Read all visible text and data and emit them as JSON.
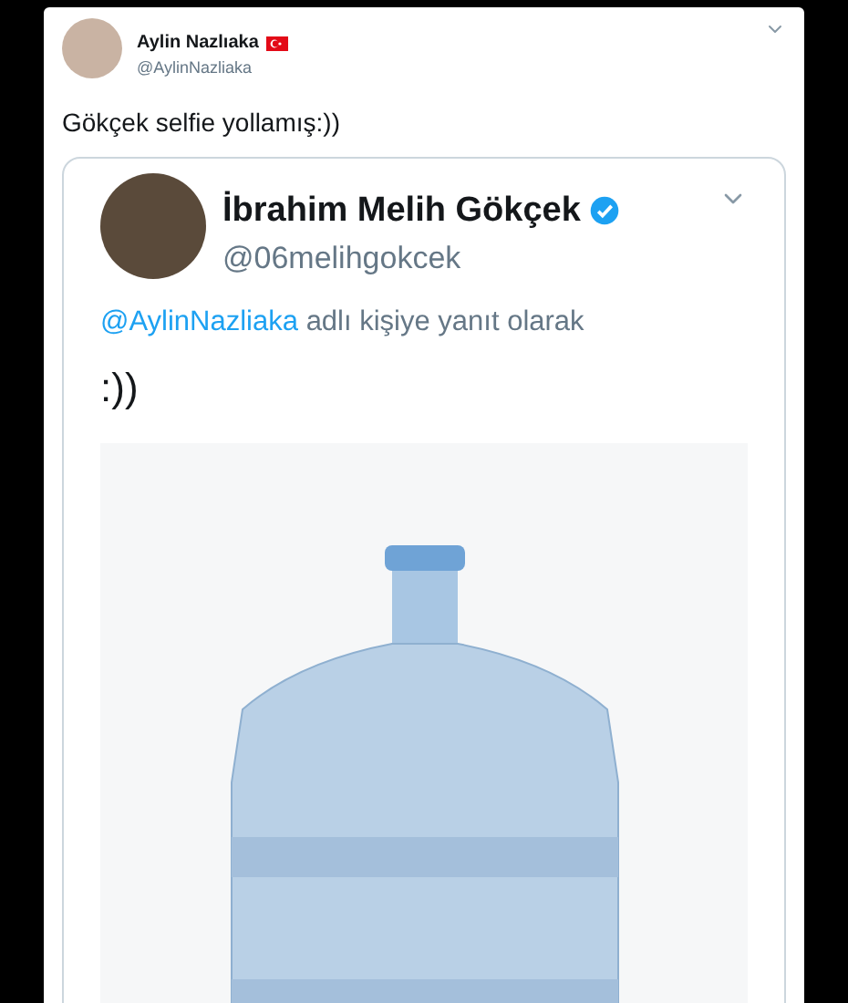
{
  "tweet": {
    "author": {
      "name": "Aylin Nazlıaka",
      "handle": "@AylinNazliaka"
    },
    "text": "Gökçek selfie yollamış:))",
    "quoted_tweet": {
      "author": {
        "name": "İbrahim Melih Gökçek",
        "handle": "@06melihgokcek",
        "verified": true
      },
      "reply_to": {
        "mention": "@AylinNazliaka",
        "text": "adlı kişiye yanıt olarak"
      },
      "text": ":))"
    }
  }
}
